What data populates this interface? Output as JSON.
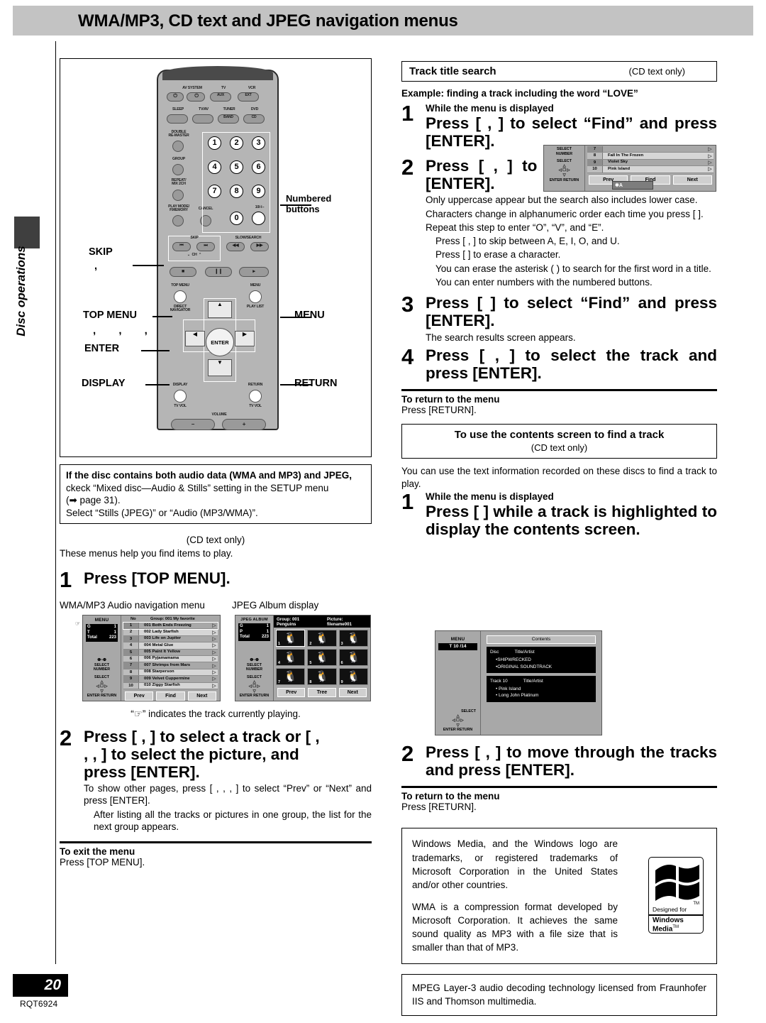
{
  "header": {
    "title": "WMA/MP3, CD text and JPEG navigation menus"
  },
  "side_tab": {
    "label": "Disc operations"
  },
  "footer": {
    "page_number": "20",
    "model_code": "RQT6924"
  },
  "remote": {
    "top_row": {
      "power": "⏻",
      "av_system": "AV SYSTEM",
      "av_power": "⏻",
      "tv": "TV",
      "aux": "AUX",
      "vcr": "VCR",
      "ext": "EXT"
    },
    "second_row": {
      "sleep": "SLEEP",
      "tvav": "TV/AV",
      "tuner": "TUNER",
      "band": "BAND",
      "dvd": "DVD",
      "cd": "CD"
    },
    "left_buttons": [
      {
        "label": "DOUBLE\nRE-MASTER"
      },
      {
        "label": "GROUP"
      },
      {
        "label": "REPEAT/\nMIX 2CH"
      },
      {
        "label": "PLAY MODE/\nP.MEMORY"
      }
    ],
    "cancel_label": "CANCEL",
    "numbers": [
      "1",
      "2",
      "3",
      "4",
      "5",
      "6",
      "7",
      "8",
      "9",
      "0"
    ],
    "ten_label": "10/-/--",
    "skip_label": "SKIP",
    "ch_label": "CH",
    "slow_search_label": "SLOW/SEARCH",
    "top_menu_label": "TOP MENU",
    "direct_navigator_label": "DIRECT\nNAVIGATOR",
    "menu_label": "MENU",
    "play_list_label": "PLAY LIST",
    "display_label": "DISPLAY",
    "return_label": "RETURN",
    "tv_vol_label": "TV VOL",
    "enter_label": "ENTER",
    "volume_label": "VOLUME",
    "volume_minus": "–",
    "volume_plus": "+"
  },
  "callouts": {
    "numbered_buttons": "Numbered\nbuttons",
    "skip": "SKIP",
    "top_menu": "TOP MENU",
    "enter": "ENTER",
    "display": "DISPLAY",
    "menu": "MENU",
    "return": "RETURN",
    "commas_skip": ",",
    "commas_enter": ",  ,  ,"
  },
  "left": {
    "mixed_disc_note": {
      "bold_lead": "If the disc contains both audio data (WMA and MP3) and JPEG,",
      "line2": "ckeck “Mixed disc—Audio & Stills” setting in the SETUP menu",
      "line3": "(➡ page 31).",
      "line4": "Select “Stills (JPEG)” or “Audio (MP3/WMA)”."
    },
    "cd_text_only": "(CD text only)",
    "intro": "These menus help you find items to play.",
    "step1": {
      "num": "1",
      "head": "Press [TOP MENU]."
    },
    "captions": {
      "audio_menu": "WMA/MP3 Audio navigation menu",
      "jpeg_album": "JPEG Album display"
    },
    "pointer_note": "“☞” indicates the track currently playing.",
    "step2": {
      "num": "2",
      "head_line1": "Press [   ,    ] to select a track or [   ,",
      "head_line2": "   ,    ,    ] to select the picture, and",
      "head_line3": "press [ENTER].",
      "note1": "To show other pages, press [   ,    ,    ,    ] to select “Prev” or “Next” and press [ENTER].",
      "note2": "After listing all the tracks or pictures in one group, the list for the next group appears."
    },
    "exit": {
      "heading": "To exit the menu",
      "body": "Press [TOP MENU]."
    }
  },
  "audio_menu_osd": {
    "side_title": "MENU",
    "status": [
      {
        "key": "G",
        "val": "1"
      },
      {
        "key": "T",
        "val": "1"
      },
      {
        "key": "Total",
        "val": "223"
      }
    ],
    "glyphs": [
      "❶~❿",
      "SELECT",
      "NUMBER",
      "SELECT",
      "△",
      "◁ ☐ ▷",
      "▽",
      "ENTER  RETURN"
    ],
    "col_no": "No",
    "col_group": "Group:  001 My favorite",
    "rows": [
      {
        "no": "1",
        "title": "001 Both Ends Freezing"
      },
      {
        "no": "2",
        "title": "002 Lady Starfish"
      },
      {
        "no": "3",
        "title": "003 Life on Jupiter"
      },
      {
        "no": "4",
        "title": "004 Metal Glue"
      },
      {
        "no": "5",
        "title": "005 Paint It Yellow"
      },
      {
        "no": "6",
        "title": "006 Pyjamamama"
      },
      {
        "no": "7",
        "title": "007 Shrimps from Mars"
      },
      {
        "no": "8",
        "title": "008 Starperson"
      },
      {
        "no": "9",
        "title": "009 Velvet Cuppermine"
      },
      {
        "no": "10",
        "title": "010 Ziggy Starfish"
      }
    ],
    "buttons": [
      "Prev",
      "Find",
      "Next"
    ]
  },
  "jpeg_album_osd": {
    "side_title": "JPEG ALBUM",
    "status": [
      {
        "key": "G",
        "val": "1"
      },
      {
        "key": "P",
        "val": "1"
      },
      {
        "key": "Total",
        "val": "223"
      }
    ],
    "glyphs": [
      "❶~❿",
      "SELECT",
      "NUMBER",
      "SELECT",
      "△",
      "◁ ☐ ▷",
      "▽",
      "ENTER  RETURN"
    ],
    "topbar_group": "Group:  001 Penguins",
    "topbar_picture": "Picture: filename001",
    "thumbs": [
      "1",
      "2",
      "3",
      "4",
      "5",
      "6",
      "7",
      "8",
      "9"
    ],
    "buttons": [
      "Prev",
      "Tree",
      "Next"
    ]
  },
  "right": {
    "track_title_search": {
      "heading": "Track title search",
      "sub": "(CD text only)"
    },
    "example": "Example: finding a track including the word “LOVE”",
    "step1": {
      "num": "1",
      "pre": "While the menu is displayed",
      "head": "Press [   ,    ] to select “Find” and press [ENTER]."
    },
    "step2": {
      "num": "2",
      "head": "Press [   ,    ] to select “L” and press [ENTER].",
      "notes": [
        "Only uppercase appear but the search also includes lower case.",
        "Characters change in alphanumeric order each time you press [   ].",
        "Repeat this step to enter “O”, “V”, and “E”."
      ],
      "subnotes": [
        "Press [      ,      ] to skip between A, E, I, O, and U.",
        "Press [   ] to erase a character.",
        "You can erase the asterisk (   ) to search for the first word in a title.",
        "You can enter numbers with the numbered buttons."
      ]
    },
    "step3": {
      "num": "3",
      "head": "Press [   ] to select “Find” and press [ENTER].",
      "note": "The search results screen appears."
    },
    "step4": {
      "num": "4",
      "head": "Press [   ,    ] to select the track and press [ENTER]."
    },
    "return1": {
      "heading": "To return to the menu",
      "body": "Press [RETURN]."
    },
    "contents_header": {
      "heading": "To use the contents screen to find a track",
      "sub": "(CD text only)"
    },
    "contents_intro": "You can use the text information recorded on these discs to find a track to play.",
    "contents_step1": {
      "num": "1",
      "pre": "While the menu is displayed",
      "head": "Press [   ] while a track is highlighted to display the contents screen."
    },
    "contents_step2": {
      "num": "2",
      "head": "Press [   ,    ] to move through the tracks and press [ENTER]."
    },
    "return2": {
      "heading": "To return to the menu",
      "body": "Press [RETURN]."
    },
    "trademark_box": {
      "p1": "Windows Media, and the Windows logo are trademarks, or registered trademarks of Microsoft Corporation in the United States and/or other countries.",
      "p2": "WMA is a compression format developed by Microsoft Corporation. It achieves the same sound quality as MP3 with a file size that is smaller than that of MP3."
    },
    "windows_logo": {
      "designed_for": "Designed for",
      "windows": "Windows",
      "media": "Media",
      "tm": "TM"
    },
    "mpeg_box": "MPEG Layer-3 audio decoding technology licensed from Fraunhofer IIS and Thomson multimedia."
  },
  "search_inset_osd": {
    "side_glyphs": [
      "SELECT",
      "NUMBER",
      "SELECT",
      "△",
      "◁ ☐ ▷",
      "▽",
      "ENTER  RETURN"
    ],
    "rows": [
      {
        "no": "7",
        "title": ""
      },
      {
        "no": "8",
        "title": "Fall In The Frozen"
      },
      {
        "no": "9",
        "title": "Violet Sky"
      },
      {
        "no": "10",
        "title": "Pink Island"
      }
    ],
    "buttons": [
      "Prev",
      "Find",
      "Next"
    ],
    "entry_overlay": "✱A"
  },
  "contents_osd": {
    "side_title": "MENU",
    "status_line": "T   10 /14",
    "glyphs": [
      "SELECT",
      "△",
      "◁ ☐ ▷",
      "▽",
      "ENTER  RETURN"
    ],
    "header": "Contents",
    "block1": {
      "c1": "Disc",
      "c2": "Title/Artist",
      "items": [
        "SHIPWRECKED",
        "ORIGINAL SOUNDTRACK"
      ]
    },
    "block2": {
      "c1": "Track 10",
      "c2": "Title/Artist",
      "items": [
        "Pink Island",
        "Long John Platinum"
      ]
    }
  }
}
